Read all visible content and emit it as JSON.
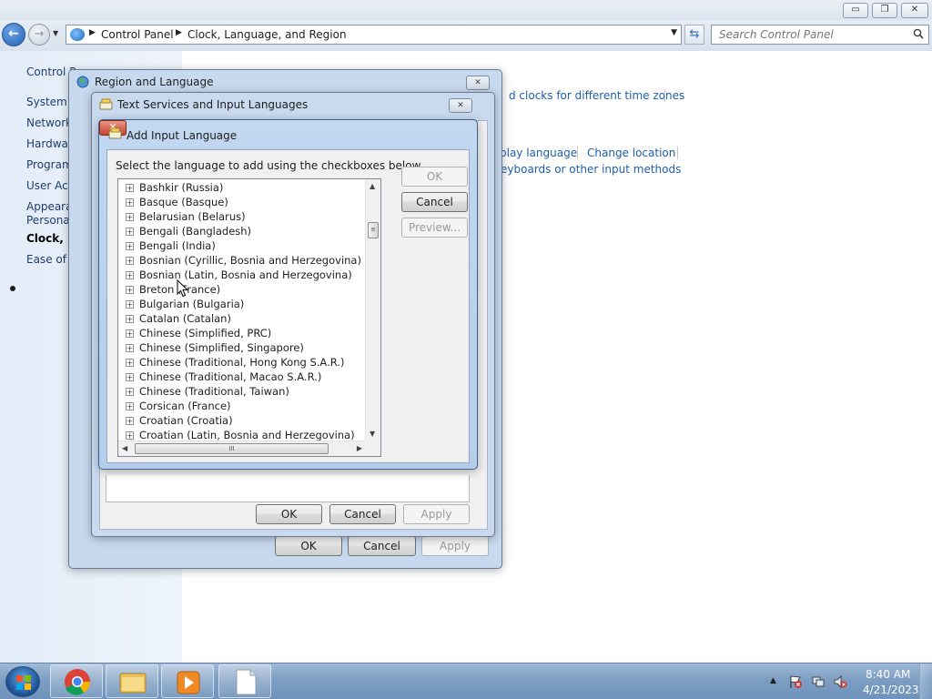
{
  "explorer": {
    "address": {
      "breadcrumbs": [
        "Control Panel",
        "Clock, Language, and Region"
      ]
    },
    "search_placeholder": "Search Control Panel",
    "window_buttons": {
      "minimize": "▭",
      "maximize": "❐",
      "close": "✕"
    }
  },
  "left_pane": {
    "items": [
      "Control P",
      "System a",
      "Network",
      "Hardwar",
      "Program",
      "User Acc",
      "Appearar",
      "Personal",
      "Clock, La",
      "Ease of A"
    ],
    "active_index": 8
  },
  "background_links": [
    "d clocks for different time zones",
    "play language",
    "Change location",
    "eyboards or other input methods"
  ],
  "region_dialog": {
    "title": "Region and Language",
    "buttons": {
      "ok": "OK",
      "cancel": "Cancel",
      "apply": "Apply"
    }
  },
  "text_services_dialog": {
    "title": "Text Services and Input Languages",
    "buttons": {
      "ok": "OK",
      "cancel": "Cancel",
      "apply": "Apply"
    }
  },
  "add_input_dialog": {
    "title": "Add Input Language",
    "instruction": "Select the language to add using the checkboxes below.",
    "buttons": {
      "ok": "OK",
      "cancel": "Cancel",
      "preview": "Preview..."
    },
    "languages": [
      "Bashkir (Russia)",
      "Basque (Basque)",
      "Belarusian (Belarus)",
      "Bengali (Bangladesh)",
      "Bengali (India)",
      "Bosnian (Cyrillic, Bosnia and Herzegovina)",
      "Bosnian (Latin, Bosnia and Herzegovina)",
      "Breton (France)",
      "Bulgarian (Bulgaria)",
      "Catalan (Catalan)",
      "Chinese (Simplified, PRC)",
      "Chinese (Simplified, Singapore)",
      "Chinese (Traditional, Hong Kong S.A.R.)",
      "Chinese (Traditional, Macao S.A.R.)",
      "Chinese (Traditional, Taiwan)",
      "Corsican (France)",
      "Croatian (Croatia)",
      "Croatian (Latin, Bosnia and Herzegovina)"
    ],
    "expander_glyph": "+"
  },
  "taskbar": {
    "apps": [
      "Google Chrome",
      "Windows Explorer",
      "Media Player",
      "Notepad"
    ],
    "clock": {
      "time": "8:40 AM",
      "date": "4/21/2023"
    }
  },
  "colors": {
    "link": "#1e5fa8",
    "title_bar": "#c7d9ee",
    "close_red": "#c7432e",
    "taskbar": "#7d9ec3"
  }
}
